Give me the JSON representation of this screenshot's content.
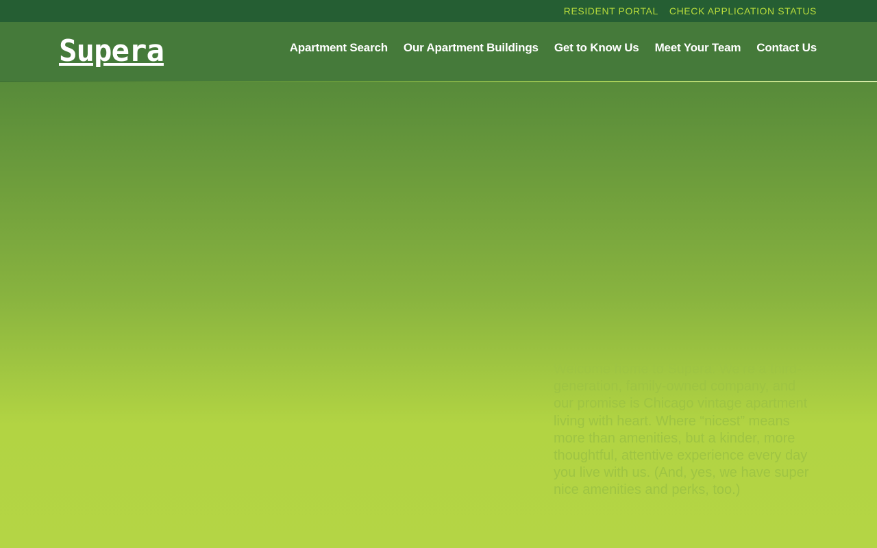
{
  "utility": {
    "links": [
      {
        "label": "RESIDENT PORTAL"
      },
      {
        "label": "CHECK APPLICATION STATUS"
      }
    ]
  },
  "header": {
    "logo": "Supera",
    "nav": [
      {
        "label": "Apartment Search"
      },
      {
        "label": "Our Apartment Buildings"
      },
      {
        "label": "Get to Know Us"
      },
      {
        "label": "Meet Your Team"
      },
      {
        "label": "Contact Us"
      }
    ]
  },
  "hero": {
    "intro": "Welcome home to Supera. We’re a third-generation, family-owned company, and our promise is Chicago vintage apartment living with heart. Where “nicest” means more than amenities, but a kinder, more thoughtful, attentive experience every day you live with us. (And, yes, we have super nice amenities and perks, too.)"
  },
  "colors": {
    "utility_bar": "#255e33",
    "header": "#457a3a",
    "accent": "#b8dc3c",
    "hero_bottom": "#b4d545"
  }
}
